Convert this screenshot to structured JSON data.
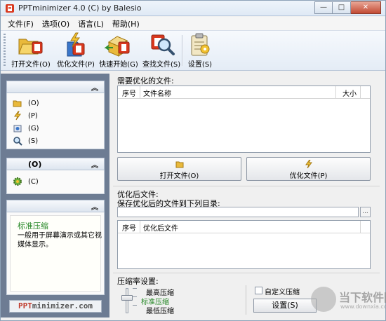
{
  "window": {
    "title": "PPTminimizer 4.0 (C) by Balesio"
  },
  "window_controls": {
    "minimize": "—",
    "maximize": "□",
    "close": "✕"
  },
  "menu": [
    "文件(F)",
    "选项(O)",
    "语言(L)",
    "帮助(H)"
  ],
  "toolbar": {
    "open": "打开文件(O)",
    "optimize": "优化文件(P)",
    "quickstart": "快速开始(G)",
    "find": "查找文件(S)",
    "settings": "设置(S)"
  },
  "left_panel": {
    "actions": [
      "(O)",
      "(P)",
      "(G)",
      "(S)"
    ],
    "section2_title": "(O)",
    "section2_item": "(C)",
    "preset_title": "标准压缩",
    "preset_desc": "一般用于屏幕演示或其它视媒体显示。",
    "logo_part1": "PPT",
    "logo_part2": "minimizer",
    "logo_part3": ".com"
  },
  "files_to_optimize": {
    "label": "需要优化的文件:",
    "columns": [
      "序号",
      "文件名称",
      "大小"
    ],
    "open_button": "打开文件(O)",
    "optimize_button": "优化文件(P)"
  },
  "optimized_files": {
    "label": "优化后文件:",
    "sublabel": "保存优化后的文件到下列目录:",
    "browse": "...",
    "columns": [
      "序号",
      "优化后文件"
    ]
  },
  "compression": {
    "label": "压缩率设置:",
    "levels": [
      "最高压缩",
      "标准压缩",
      "最低压缩"
    ],
    "selected_index": 1,
    "custom_checkbox": "自定义压缩",
    "settings_button": "设置(S)"
  },
  "watermark": {
    "text": "当下软件园",
    "url": "www.downxia.com"
  },
  "colors": {
    "accent_green": "#2a8a2a",
    "left_panel_bg": "#6d7c93"
  }
}
